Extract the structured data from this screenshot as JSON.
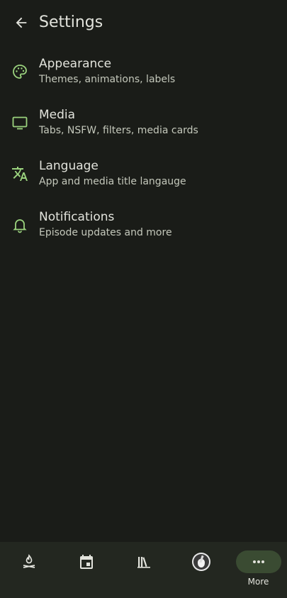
{
  "header": {
    "title": "Settings",
    "back_icon": "arrow-back-icon"
  },
  "accent_color": "#9bd37e",
  "settings": [
    {
      "id": "appearance",
      "icon": "palette-icon",
      "title": "Appearance",
      "subtitle": "Themes, animations, labels"
    },
    {
      "id": "media",
      "icon": "tv-icon",
      "title": "Media",
      "subtitle": "Tabs, NSFW, filters, media cards"
    },
    {
      "id": "language",
      "icon": "translate-icon",
      "title": "Language",
      "subtitle": "App and media title langauge"
    },
    {
      "id": "notifications",
      "icon": "bell-icon",
      "title": "Notifications",
      "subtitle": "Episode updates and more"
    }
  ],
  "bottom_nav": {
    "items": [
      {
        "id": "home",
        "icon": "campfire-icon",
        "label": ""
      },
      {
        "id": "calendar",
        "icon": "calendar-icon",
        "label": ""
      },
      {
        "id": "library",
        "icon": "library-icon",
        "label": ""
      },
      {
        "id": "profile",
        "icon": "avatar",
        "label": ""
      },
      {
        "id": "more",
        "icon": "more-horizontal-icon",
        "label": "More",
        "active": true
      }
    ]
  }
}
